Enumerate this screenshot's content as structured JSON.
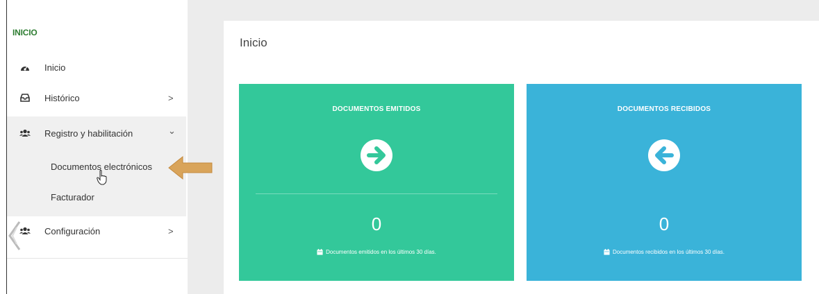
{
  "sidebar": {
    "section_title": "INICIO",
    "items": [
      {
        "label": "Inicio",
        "icon": "dashboard-icon"
      },
      {
        "label": "Histórico",
        "icon": "inbox-icon",
        "chevron": ">"
      },
      {
        "label": "Registro y habilitación",
        "icon": "users-icon",
        "chevron": "⌄"
      },
      {
        "label": "Configuración",
        "icon": "users-icon",
        "chevron": ">"
      }
    ],
    "sub_items": [
      {
        "label": "Documentos electrónicos"
      },
      {
        "label": "Facturador"
      }
    ]
  },
  "main": {
    "title": "Inicio",
    "cards": [
      {
        "title": "DOCUMENTOS EMITIDOS",
        "value": "0",
        "footer": "Documentos emitidos en los últimos 30 días.",
        "icon": "arrow-right-circle-icon",
        "color": "#33c89a"
      },
      {
        "title": "DOCUMENTOS RECIBIDOS",
        "value": "0",
        "footer": "Documentos recibidos en los últimos 30 días.",
        "icon": "arrow-left-circle-icon",
        "color": "#3ab3d9"
      }
    ]
  },
  "colors": {
    "accent_green": "#2e7d32",
    "callout_arrow": "#d9a45a"
  }
}
